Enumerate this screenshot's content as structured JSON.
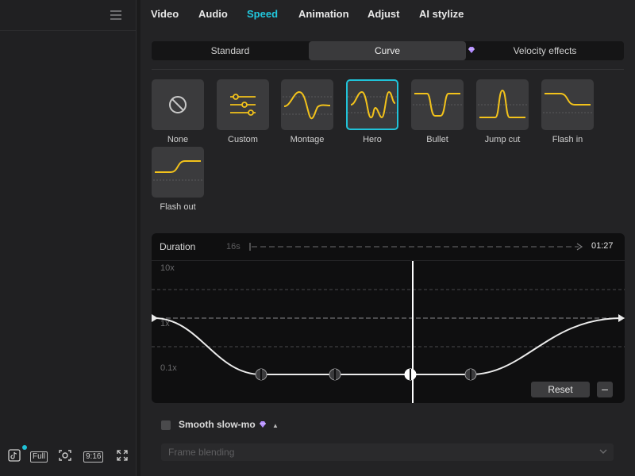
{
  "tabs": [
    {
      "label": "Video"
    },
    {
      "label": "Audio"
    },
    {
      "label": "Speed"
    },
    {
      "label": "Animation"
    },
    {
      "label": "Adjust"
    },
    {
      "label": "AI stylize"
    }
  ],
  "active_tab": "Speed",
  "speed_modes": [
    {
      "label": "Standard"
    },
    {
      "label": "Curve"
    },
    {
      "label": "Velocity effects"
    }
  ],
  "active_mode": "Curve",
  "presets": [
    {
      "label": "None"
    },
    {
      "label": "Custom"
    },
    {
      "label": "Montage"
    },
    {
      "label": "Hero"
    },
    {
      "label": "Bullet"
    },
    {
      "label": "Jump cut"
    },
    {
      "label": "Flash in"
    },
    {
      "label": "Flash out"
    }
  ],
  "active_preset": "Hero",
  "editor": {
    "duration_label": "Duration",
    "original_duration": "16s",
    "new_duration": "01:27",
    "speed_labels": [
      "10x",
      "1x",
      "0.1x"
    ],
    "reset_label": "Reset",
    "minus_label": "–"
  },
  "smooth_slowmo": {
    "label": "Smooth slow-mo",
    "checked": false
  },
  "frame_blending": {
    "placeholder": "Frame blending"
  },
  "left_toolbar": {
    "full_label": "Full",
    "ratio_label": "9:16"
  },
  "colors": {
    "accent": "#21c8de",
    "curve_yellow": "#f2c21b",
    "premium": "#b48cff"
  },
  "icons": [
    "hamburger-icon",
    "tiktok-icon",
    "full-icon",
    "screenshot-icon",
    "ratio-icon",
    "fullscreen-icon",
    "premium-gem-icon",
    "no-entry-icon",
    "sliders-icon",
    "caret-up-icon",
    "chevron-down-icon"
  ]
}
